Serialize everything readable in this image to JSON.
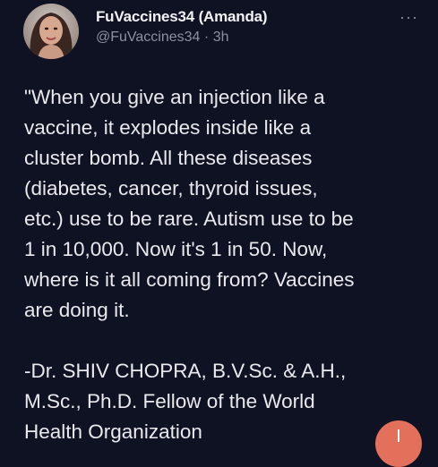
{
  "tweet": {
    "display_name": "FuVaccines34 (Amanda)",
    "handle": "@FuVaccines34",
    "separator": "·",
    "time": "3h",
    "more_label": "···",
    "text": "\"When you give an injection like a\nvaccine, it explodes inside like a\ncluster bomb. All these diseases\n(diabetes, cancer, thyroid issues,\netc.) use to be rare. Autism use to be\n1 in 10,000. Now it's 1 in 50. Now,\nwhere is it all coming from? Vaccines\nare doing it.\n\n-Dr. SHIV CHOPRA, B.V.Sc. & A.H.,\nM.Sc., Ph.D. Fellow of the World\nHealth Organization"
  },
  "icons": {
    "more": "more-horizontal-icon",
    "compose": "compose-icon"
  },
  "colors": {
    "background": "#0f1222",
    "text": "#e9e9ee",
    "secondary": "#8d90a0",
    "fab": "#e2705a"
  }
}
